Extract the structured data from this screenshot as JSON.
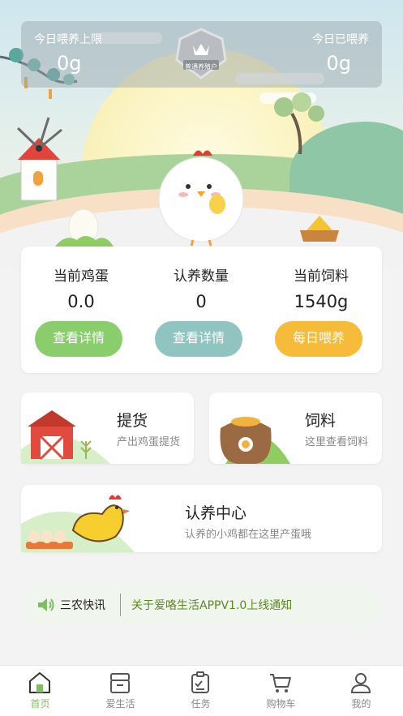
{
  "header": {
    "daily_limit_label": "今日喂养上限",
    "daily_limit_value": "0g",
    "daily_fed_label": "今日已喂养",
    "daily_fed_value": "0g",
    "badge_text": "普通养殖户"
  },
  "stats": [
    {
      "title": "当前鸡蛋",
      "value": "0.0",
      "button": "查看详情",
      "color": "#8acd6c"
    },
    {
      "title": "认养数量",
      "value": "0",
      "button": "查看详情",
      "color": "#8fc4c0"
    },
    {
      "title": "当前饲料",
      "value": "1540g",
      "button": "每日喂养",
      "color": "#f7bb3a"
    }
  ],
  "features": {
    "pickup": {
      "title": "提货",
      "subtitle": "产出鸡蛋提货"
    },
    "feed": {
      "title": "饲料",
      "subtitle": "这里查看饲料"
    },
    "adopt": {
      "title": "认养中心",
      "subtitle": "认养的小鸡都在这里产蛋哦"
    }
  },
  "notice": {
    "tag": "三农快讯",
    "text": "关于爱咯生活APPV1.0上线通知"
  },
  "tabs": [
    {
      "label": "首页",
      "icon": "home-icon",
      "active": true
    },
    {
      "label": "爱生活",
      "icon": "shop-icon",
      "active": false
    },
    {
      "label": "任务",
      "icon": "task-icon",
      "active": false
    },
    {
      "label": "购物车",
      "icon": "cart-icon",
      "active": false
    },
    {
      "label": "我的",
      "icon": "profile-icon",
      "active": false
    }
  ],
  "colors": {
    "accent_green": "#7cc05e",
    "notice_green": "#5a8a1a"
  }
}
